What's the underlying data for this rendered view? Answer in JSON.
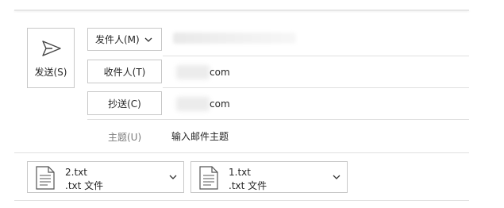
{
  "send": {
    "label": "发送(S)",
    "icon": "send-icon"
  },
  "from": {
    "label": "发件人(M)",
    "icon": "chevron-down-icon"
  },
  "to": {
    "label": "收件人(T)",
    "value_suffix": "com"
  },
  "cc": {
    "label": "抄送(C)",
    "value_suffix": "com"
  },
  "subject": {
    "label": "主题(U)",
    "placeholder": "输入邮件主题"
  },
  "attachments": [
    {
      "name": "2.txt",
      "type": ".txt 文件",
      "icon": "text-file-icon"
    },
    {
      "name": "1.txt",
      "type": ".txt 文件",
      "icon": "text-file-icon"
    }
  ],
  "colors": {
    "border": "#c8c8c8",
    "separator": "#e0e0e0",
    "text": "#262626",
    "muted": "#7a7a7a"
  }
}
